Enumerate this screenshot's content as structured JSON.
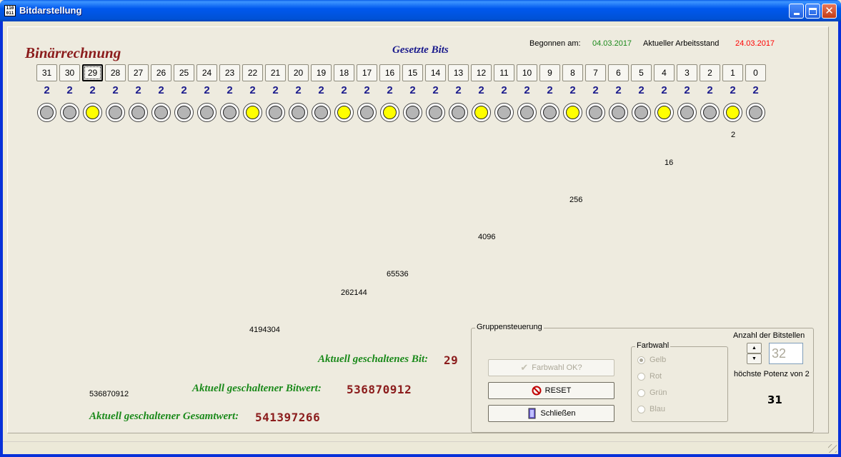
{
  "window": {
    "title": "Bitdarstellung",
    "icon": "binary-app-icon"
  },
  "header": {
    "heading": "Binärrechnung",
    "gesetzte_bits": "Gesetzte Bits",
    "begonnen_label": "Begonnen am:",
    "begonnen_date": "04.03.2017",
    "arbeitsstand_label": "Aktueller Arbeitsstand",
    "arbeitsstand_date": "24.03.2017"
  },
  "bits": {
    "labels": [
      "31",
      "30",
      "29",
      "28",
      "27",
      "26",
      "25",
      "24",
      "23",
      "22",
      "21",
      "20",
      "19",
      "18",
      "17",
      "16",
      "15",
      "14",
      "13",
      "12",
      "11",
      "10",
      "9",
      "8",
      "7",
      "6",
      "5",
      "4",
      "3",
      "2",
      "1",
      "0"
    ],
    "base": "2",
    "selected": "29",
    "on": [
      29,
      22,
      18,
      16,
      12,
      8,
      4,
      1
    ]
  },
  "powers": [
    "2",
    "16",
    "256",
    "4096",
    "65536",
    "262144",
    "4194304",
    "536870912"
  ],
  "results": {
    "bit_label": "Aktuell geschaltenes Bit:",
    "bit_value": "29",
    "bitwert_label": "Aktuell geschaltener Bitwert:",
    "bitwert_value": "536870912",
    "gesamt_label": "Aktuell geschaltener Gesamtwert:",
    "gesamt_value": "541397266"
  },
  "group": {
    "title": "Gruppensteuerung",
    "farbwahl_ok": "Farbwahl OK?",
    "reset": "RESET",
    "schliessen": "Schließen",
    "farbwahl_title": "Farbwahl",
    "radios": [
      "Gelb",
      "Rot",
      "Grün",
      "Blau"
    ],
    "radio_selected": "Gelb",
    "anzahl_label": "Anzahl der Bitstellen",
    "anzahl_value": "32",
    "potenz_label": "höchste Potenz von 2",
    "potenz_value": "31"
  },
  "colors": {
    "led_on": "#ffff00",
    "led_off": "#b5b5b5",
    "heading": "#8b1c1c",
    "green_text": "#1b8a1b",
    "blue_text": "#1a1a8c"
  }
}
